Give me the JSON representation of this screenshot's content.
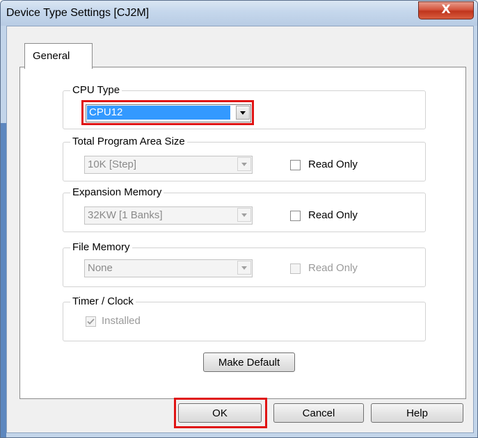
{
  "window": {
    "title": "Device Type Settings [CJ2M]",
    "close_label": "X"
  },
  "tabs": [
    {
      "label": "General"
    }
  ],
  "cpu_type": {
    "label": "CPU Type",
    "value": "CPU12"
  },
  "program_area": {
    "label": "Total Program Area Size",
    "value": "10K [Step]",
    "read_only_label": "Read Only",
    "read_only_checked": false
  },
  "expansion_memory": {
    "label": "Expansion Memory",
    "value": "32KW [1 Banks]",
    "read_only_label": "Read Only",
    "read_only_checked": false
  },
  "file_memory": {
    "label": "File Memory",
    "value": "None",
    "read_only_label": "Read Only",
    "read_only_checked": false
  },
  "timer_clock": {
    "label": "Timer / Clock",
    "installed_label": "Installed",
    "installed_checked": true
  },
  "buttons": {
    "make_default": "Make Default",
    "ok": "OK",
    "cancel": "Cancel",
    "help": "Help"
  },
  "colors": {
    "highlight": "#e01414",
    "selection": "#3399ff"
  }
}
